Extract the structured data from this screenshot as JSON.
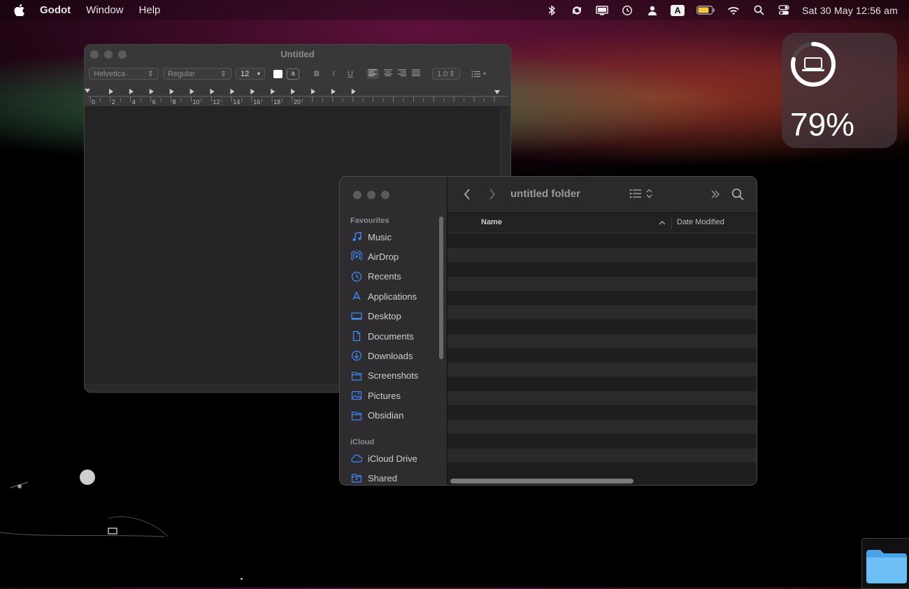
{
  "menubar": {
    "app_name": "Godot",
    "menus": [
      "Window",
      "Help"
    ],
    "clock": "Sat 30 May  12:56 am",
    "input_source": "A"
  },
  "battery_widget": {
    "percent_label": "79%",
    "level_fraction": 0.79
  },
  "textedit": {
    "title": "Untitled",
    "font_family": "Helvetica",
    "font_style": "Regular",
    "font_size": "12",
    "bold_label": "B",
    "italic_label": "I",
    "underline_label": "U",
    "line_spacing": "1.0",
    "ruler_labels": [
      "0",
      "2",
      "4",
      "6",
      "8",
      "10",
      "12",
      "14",
      "16",
      "18",
      "20"
    ]
  },
  "finder": {
    "title": "untitled folder",
    "sidebar": {
      "favourites_header": "Favourites",
      "favourites": [
        {
          "label": "Music",
          "icon": "music-note-icon"
        },
        {
          "label": "AirDrop",
          "icon": "airdrop-icon"
        },
        {
          "label": "Recents",
          "icon": "clock-icon"
        },
        {
          "label": "Applications",
          "icon": "applications-icon"
        },
        {
          "label": "Desktop",
          "icon": "desktop-icon"
        },
        {
          "label": "Documents",
          "icon": "document-icon"
        },
        {
          "label": "Downloads",
          "icon": "download-icon"
        },
        {
          "label": "Screenshots",
          "icon": "folder-icon"
        },
        {
          "label": "Pictures",
          "icon": "pictures-icon"
        },
        {
          "label": "Obsidian",
          "icon": "folder-icon"
        }
      ],
      "icloud_header": "iCloud",
      "icloud": [
        {
          "label": "iCloud Drive",
          "icon": "cloud-icon"
        },
        {
          "label": "Shared",
          "icon": "shared-folder-icon"
        }
      ]
    },
    "columns": {
      "name": "Name",
      "date_modified": "Date Modified"
    }
  },
  "colors": {
    "sidebar_icon": "#3d8af7",
    "battery_fill": "#f5c542"
  }
}
